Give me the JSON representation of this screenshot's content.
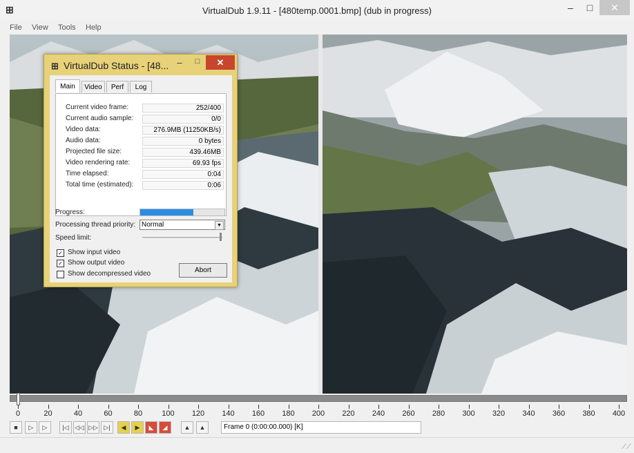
{
  "window": {
    "title": "VirtualDub 1.9.11 - [480temp.0001.bmp] (dub in progress)",
    "min": "–",
    "max": "□",
    "close": "✕"
  },
  "menu": [
    "File",
    "View",
    "Tools",
    "Help"
  ],
  "timeline": {
    "ticks": [
      "0",
      "20",
      "40",
      "60",
      "80",
      "100",
      "120",
      "140",
      "160",
      "180",
      "200",
      "220",
      "240",
      "260",
      "280",
      "300",
      "320",
      "340",
      "360",
      "380",
      "400"
    ],
    "position": 0
  },
  "toolbar": {
    "frame_text": "Frame 0 (0:00:00.000) [K]"
  },
  "dialog": {
    "title": "VirtualDub Status - [48...",
    "tabs": [
      "Main",
      "Video",
      "Perf",
      "Log"
    ],
    "rows": [
      {
        "label": "Current video frame:",
        "value": "252/400"
      },
      {
        "label": "Current audio sample:",
        "value": "0/0"
      },
      {
        "label": "Video data:",
        "value": "276.9MB (11250KB/s)"
      },
      {
        "label": "Audio data:",
        "value": "0 bytes"
      },
      {
        "label": "Projected file size:",
        "value": "439.46MB"
      },
      {
        "label": "Video rendering rate:",
        "value": "69.93 fps"
      },
      {
        "label": "Time elapsed:",
        "value": "0:04"
      },
      {
        "label": "Total time (estimated):",
        "value": "0:06"
      }
    ],
    "progress_label": "Progress:",
    "progress_fraction": 0.63,
    "priority_label": "Processing thread priority:",
    "priority_value": "Normal",
    "speed_label": "Speed limit:",
    "checks": [
      {
        "label": "Show input video",
        "checked": true
      },
      {
        "label": "Show output video",
        "checked": true
      },
      {
        "label": "Show decompressed video",
        "checked": false
      }
    ],
    "abort_label": "Abort"
  },
  "colors": {
    "dialog_frame": "#e7d179",
    "close_red": "#c7462c",
    "progress_blue": "#2a8de3"
  }
}
